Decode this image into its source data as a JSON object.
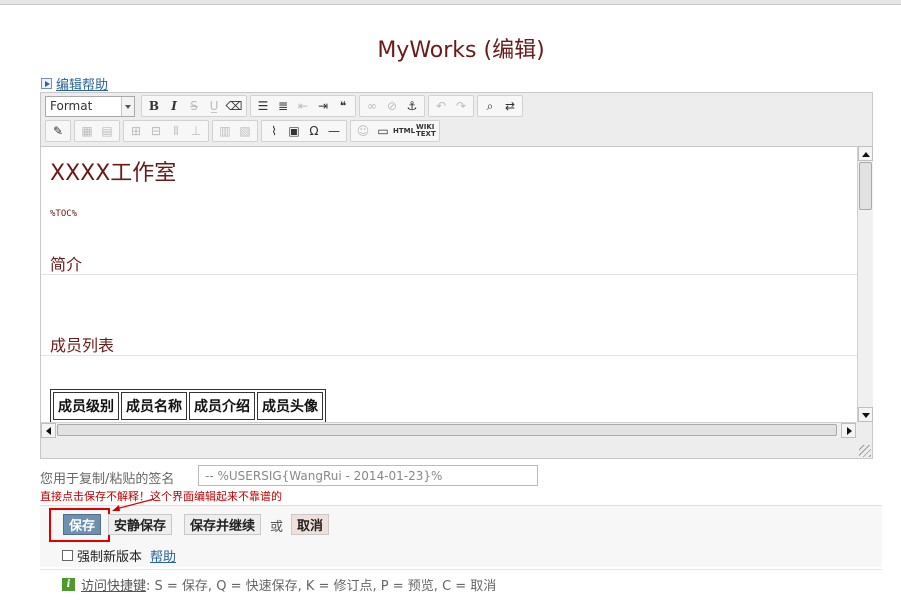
{
  "page": {
    "title": "MyWorks (编辑)"
  },
  "edit_help": {
    "label": "编辑帮助"
  },
  "toolbar": {
    "format_value": "Format",
    "row1": [
      {
        "name": "bold-icon",
        "glyph": "B",
        "cls": "bold"
      },
      {
        "name": "italic-icon",
        "glyph": "I",
        "cls": "ital"
      },
      {
        "name": "strikethrough-icon",
        "glyph": "S̶",
        "cls": "dis"
      },
      {
        "name": "underline-icon",
        "glyph": "U̲",
        "cls": "dis"
      },
      {
        "name": "eraser-icon",
        "glyph": "⌫",
        "cls": ""
      },
      {
        "name": "bulleted-list-icon",
        "glyph": "☰",
        "cls": ""
      },
      {
        "name": "numbered-list-icon",
        "glyph": "≣",
        "cls": ""
      },
      {
        "name": "outdent-icon",
        "glyph": "⇤",
        "cls": "dis"
      },
      {
        "name": "indent-icon",
        "glyph": "⇥",
        "cls": ""
      },
      {
        "name": "blockquote-icon",
        "glyph": "❝",
        "cls": ""
      },
      {
        "name": "link-icon",
        "glyph": "∞",
        "cls": "dis"
      },
      {
        "name": "unlink-icon",
        "glyph": "⊘",
        "cls": "dis"
      },
      {
        "name": "anchor-icon",
        "glyph": "⚓",
        "cls": ""
      },
      {
        "name": "undo-icon",
        "glyph": "↶",
        "cls": "dis"
      },
      {
        "name": "redo-icon",
        "glyph": "↷",
        "cls": "dis"
      },
      {
        "name": "find-icon",
        "glyph": "⌕",
        "cls": ""
      },
      {
        "name": "replace-icon",
        "glyph": "⇄",
        "cls": ""
      }
    ],
    "row2": [
      {
        "name": "edit-source-icon",
        "glyph": "✎",
        "cls": ""
      },
      {
        "name": "table-icon",
        "glyph": "▦",
        "cls": "dis"
      },
      {
        "name": "table-props-icon",
        "glyph": "▤",
        "cls": "dis"
      },
      {
        "name": "insert-row-icon",
        "glyph": "⊞",
        "cls": "dis"
      },
      {
        "name": "delete-row-icon",
        "glyph": "⊟",
        "cls": "dis"
      },
      {
        "name": "insert-column-icon",
        "glyph": "⫴",
        "cls": "dis"
      },
      {
        "name": "delete-column-icon",
        "glyph": "⊥",
        "cls": "dis"
      },
      {
        "name": "merge-cells-icon",
        "glyph": "▥",
        "cls": "dis"
      },
      {
        "name": "split-cells-icon",
        "glyph": "▧",
        "cls": "dis"
      },
      {
        "name": "attach-icon",
        "glyph": "⌇",
        "cls": ""
      },
      {
        "name": "image-icon",
        "glyph": "▣",
        "cls": ""
      },
      {
        "name": "special-char-icon",
        "glyph": "Ω",
        "cls": ""
      },
      {
        "name": "horizontal-rule-icon",
        "glyph": "—",
        "cls": ""
      },
      {
        "name": "smiley-icon",
        "glyph": "☺",
        "cls": "dis"
      },
      {
        "name": "window-icon",
        "glyph": "▭",
        "cls": ""
      },
      {
        "name": "html-icon",
        "glyph": "HTML",
        "cls": "small"
      },
      {
        "name": "wiki-text-icon",
        "glyph": "WIKI TEXT",
        "cls": "small"
      }
    ]
  },
  "content": {
    "heading1": "XXXX工作室",
    "toc": "%TOC%",
    "heading_intro": "简介",
    "heading_members": "成员列表",
    "table_headers": [
      "成员级别",
      "成员名称",
      "成员介绍",
      "成员头像"
    ]
  },
  "signature": {
    "label": "您用于复制/粘贴的签名",
    "value": "-- %USERSIG{WangRui - 2014-01-23}%"
  },
  "warning": "直接点击保存不解释！这个界面编辑起来不靠谱的",
  "actions": {
    "save": "保存",
    "quiet_save": "安静保存",
    "save_continue": "保存并继续",
    "or": "或",
    "cancel": "取消",
    "force_new_revision": "强制新版本",
    "help": "帮助"
  },
  "shortcuts": {
    "link": "访问快捷键",
    "text": ": S = 保存, Q = 快速保存, K = 修订点, P = 预览, C = 取消"
  }
}
